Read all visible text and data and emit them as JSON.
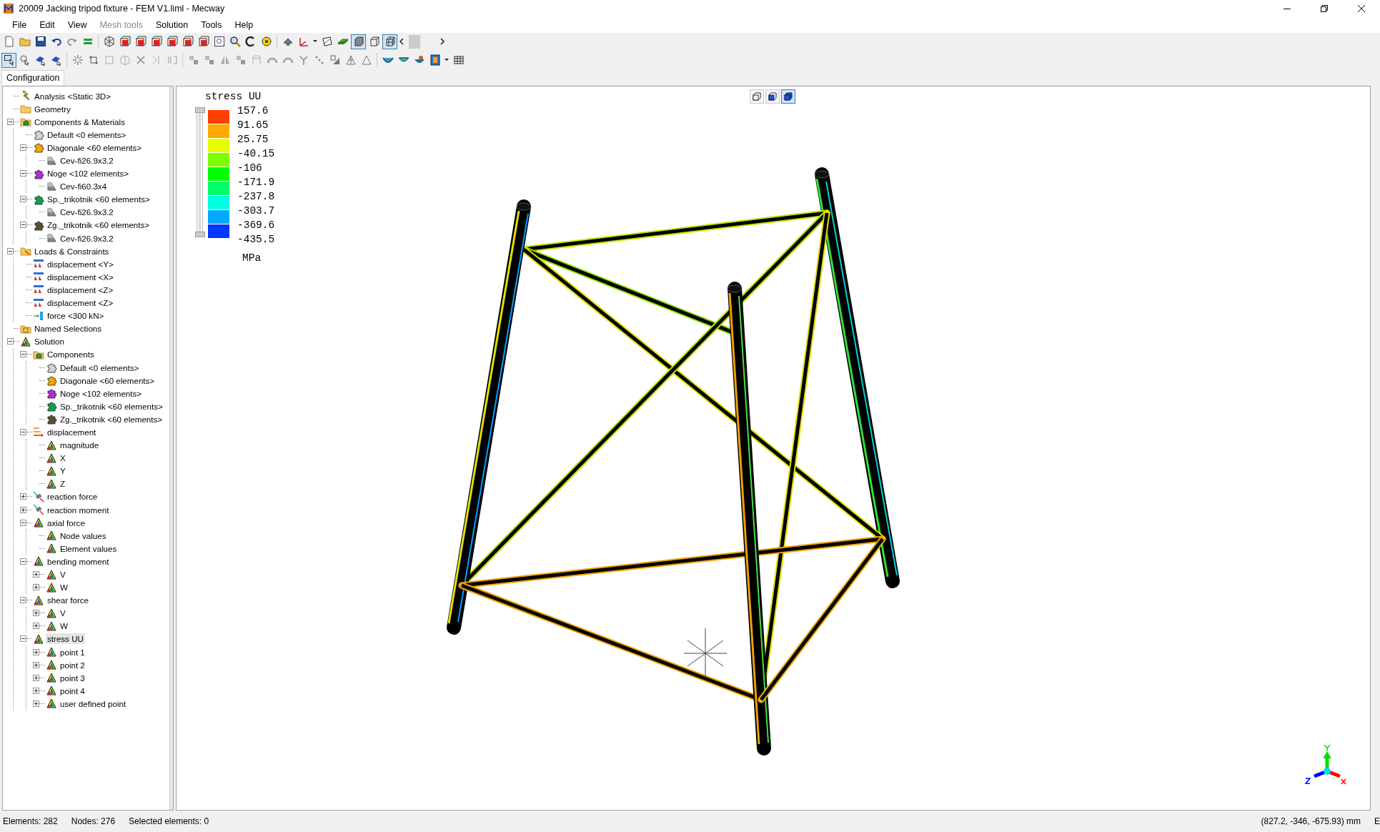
{
  "window": {
    "title": "20009 Jacking tripod fixture - FEM V1.liml - Mecway"
  },
  "menu": [
    {
      "label": "File",
      "disabled": false
    },
    {
      "label": "Edit",
      "disabled": false
    },
    {
      "label": "View",
      "disabled": false
    },
    {
      "label": "Mesh tools",
      "disabled": true
    },
    {
      "label": "Solution",
      "disabled": false
    },
    {
      "label": "Tools",
      "disabled": false
    },
    {
      "label": "Help",
      "disabled": false
    }
  ],
  "tabs": [
    {
      "label": "Configuration",
      "selected": true
    }
  ],
  "tree": [
    {
      "label": "Analysis <Static 3D>",
      "kind": "analysis",
      "selected": false
    },
    {
      "label": "Geometry",
      "kind": "folder",
      "selected": false
    },
    {
      "label": "Components & Materials",
      "kind": "components",
      "expanded": true,
      "selected": false,
      "children": [
        {
          "label": "Default <0 elements>",
          "kind": "component",
          "color": "#d4d4d4",
          "selected": false
        },
        {
          "label": "Diagonale <60 elements>",
          "kind": "component",
          "color": "#f5a800",
          "expanded": true,
          "selected": false,
          "children": [
            {
              "label": "Cev-fi26.9x3.2",
              "kind": "material",
              "selected": false
            }
          ]
        },
        {
          "label": "Noge <102 elements>",
          "kind": "component",
          "color": "#b02cd6",
          "expanded": true,
          "selected": false,
          "children": [
            {
              "label": "Cev-fi60.3x4",
              "kind": "material",
              "selected": false
            }
          ]
        },
        {
          "label": "Sp._trikotnik <60 elements>",
          "kind": "component",
          "color": "#10a050",
          "expanded": true,
          "selected": false,
          "children": [
            {
              "label": "Cev-fi26.9x3.2",
              "kind": "material",
              "selected": false
            }
          ]
        },
        {
          "label": "Zg._trikotnik <60 elements>",
          "kind": "component",
          "color": "#5a5030",
          "expanded": true,
          "selected": false,
          "children": [
            {
              "label": "Cev-fi26.9x3.2",
              "kind": "material",
              "selected": false
            }
          ]
        }
      ]
    },
    {
      "label": "Loads & Constraints",
      "kind": "loads",
      "expanded": true,
      "selected": false,
      "children": [
        {
          "label": "displacement <Y>",
          "kind": "constraint",
          "selected": false
        },
        {
          "label": "displacement <X>",
          "kind": "constraint",
          "selected": false
        },
        {
          "label": "displacement <Z>",
          "kind": "constraint",
          "selected": false
        },
        {
          "label": "displacement <Z>",
          "kind": "constraint",
          "selected": false
        },
        {
          "label": "force <300 kN>",
          "kind": "force",
          "selected": false
        }
      ]
    },
    {
      "label": "Named Selections",
      "kind": "selections",
      "selected": false
    },
    {
      "label": "Solution",
      "kind": "result",
      "expanded": true,
      "selected": false,
      "children": [
        {
          "label": "Components",
          "kind": "components",
          "expanded": true,
          "selected": false,
          "children": [
            {
              "label": "Default <0 elements>",
              "kind": "component",
              "color": "#d4d4d4",
              "selected": false
            },
            {
              "label": "Diagonale <60 elements>",
              "kind": "component",
              "color": "#f5a800",
              "selected": false
            },
            {
              "label": "Noge <102 elements>",
              "kind": "component",
              "color": "#b02cd6",
              "selected": false
            },
            {
              "label": "Sp._trikotnik <60 elements>",
              "kind": "component",
              "color": "#10a050",
              "selected": false
            },
            {
              "label": "Zg._trikotnik <60 elements>",
              "kind": "component",
              "color": "#5a5030",
              "selected": false
            }
          ]
        },
        {
          "label": "displacement",
          "kind": "vectors",
          "expanded": true,
          "selected": false,
          "children": [
            {
              "label": "magnitude",
              "kind": "result",
              "selected": false
            },
            {
              "label": "X",
              "kind": "result",
              "selected": false
            },
            {
              "label": "Y",
              "kind": "result",
              "selected": false
            },
            {
              "label": "Z",
              "kind": "result",
              "selected": false
            }
          ]
        },
        {
          "label": "reaction force",
          "kind": "reaction",
          "expanded": false,
          "selected": false
        },
        {
          "label": "reaction moment",
          "kind": "reaction",
          "expanded": false,
          "selected": false
        },
        {
          "label": "axial force",
          "kind": "result",
          "expanded": true,
          "selected": false,
          "children": [
            {
              "label": "Node values",
              "kind": "result",
              "selected": false
            },
            {
              "label": "Element values",
              "kind": "result",
              "selected": false
            }
          ]
        },
        {
          "label": "bending moment",
          "kind": "result",
          "expanded": true,
          "selected": false,
          "children": [
            {
              "label": "V",
              "kind": "result",
              "expanded": false,
              "selected": false
            },
            {
              "label": "W",
              "kind": "result",
              "expanded": false,
              "selected": false
            }
          ]
        },
        {
          "label": "shear force",
          "kind": "result",
          "expanded": true,
          "selected": false,
          "children": [
            {
              "label": "V",
              "kind": "result",
              "expanded": false,
              "selected": false
            },
            {
              "label": "W",
              "kind": "result",
              "expanded": false,
              "selected": false
            }
          ]
        },
        {
          "label": "stress UU",
          "kind": "result",
          "expanded": true,
          "selected": true,
          "children": [
            {
              "label": "point 1",
              "kind": "result",
              "expanded": false,
              "selected": false
            },
            {
              "label": "point 2",
              "kind": "result",
              "expanded": false,
              "selected": false
            },
            {
              "label": "point 3",
              "kind": "result",
              "expanded": false,
              "selected": false
            },
            {
              "label": "point 4",
              "kind": "result",
              "expanded": false,
              "selected": false
            },
            {
              "label": "user defined point",
              "kind": "result",
              "expanded": false,
              "selected": false
            }
          ]
        }
      ]
    }
  ],
  "legend": {
    "title": "stress UU",
    "values": [
      "157.6",
      "91.65",
      "25.75",
      "-40.15",
      "-106",
      "-171.9",
      "-237.8",
      "-303.7",
      "-369.6",
      "-435.5"
    ],
    "bands": [
      {
        "color": "#ff4000"
      },
      {
        "color": "#ffa800"
      },
      {
        "color": "#e6ff00"
      },
      {
        "color": "#7aff00"
      },
      {
        "color": "#00ff00"
      },
      {
        "color": "#00ff6a"
      },
      {
        "color": "#00ffe0"
      },
      {
        "color": "#00a8ff"
      },
      {
        "color": "#0038ff"
      }
    ],
    "unit": "MPa",
    "range_slider": {
      "level": 1
    }
  },
  "status_bar": {
    "elements": "Elements: 282",
    "nodes": "Nodes: 276",
    "selected_elements": "Selected elements: 0",
    "coordinates": "(827.2, -346, -675.93) mm",
    "column_5": "E"
  }
}
